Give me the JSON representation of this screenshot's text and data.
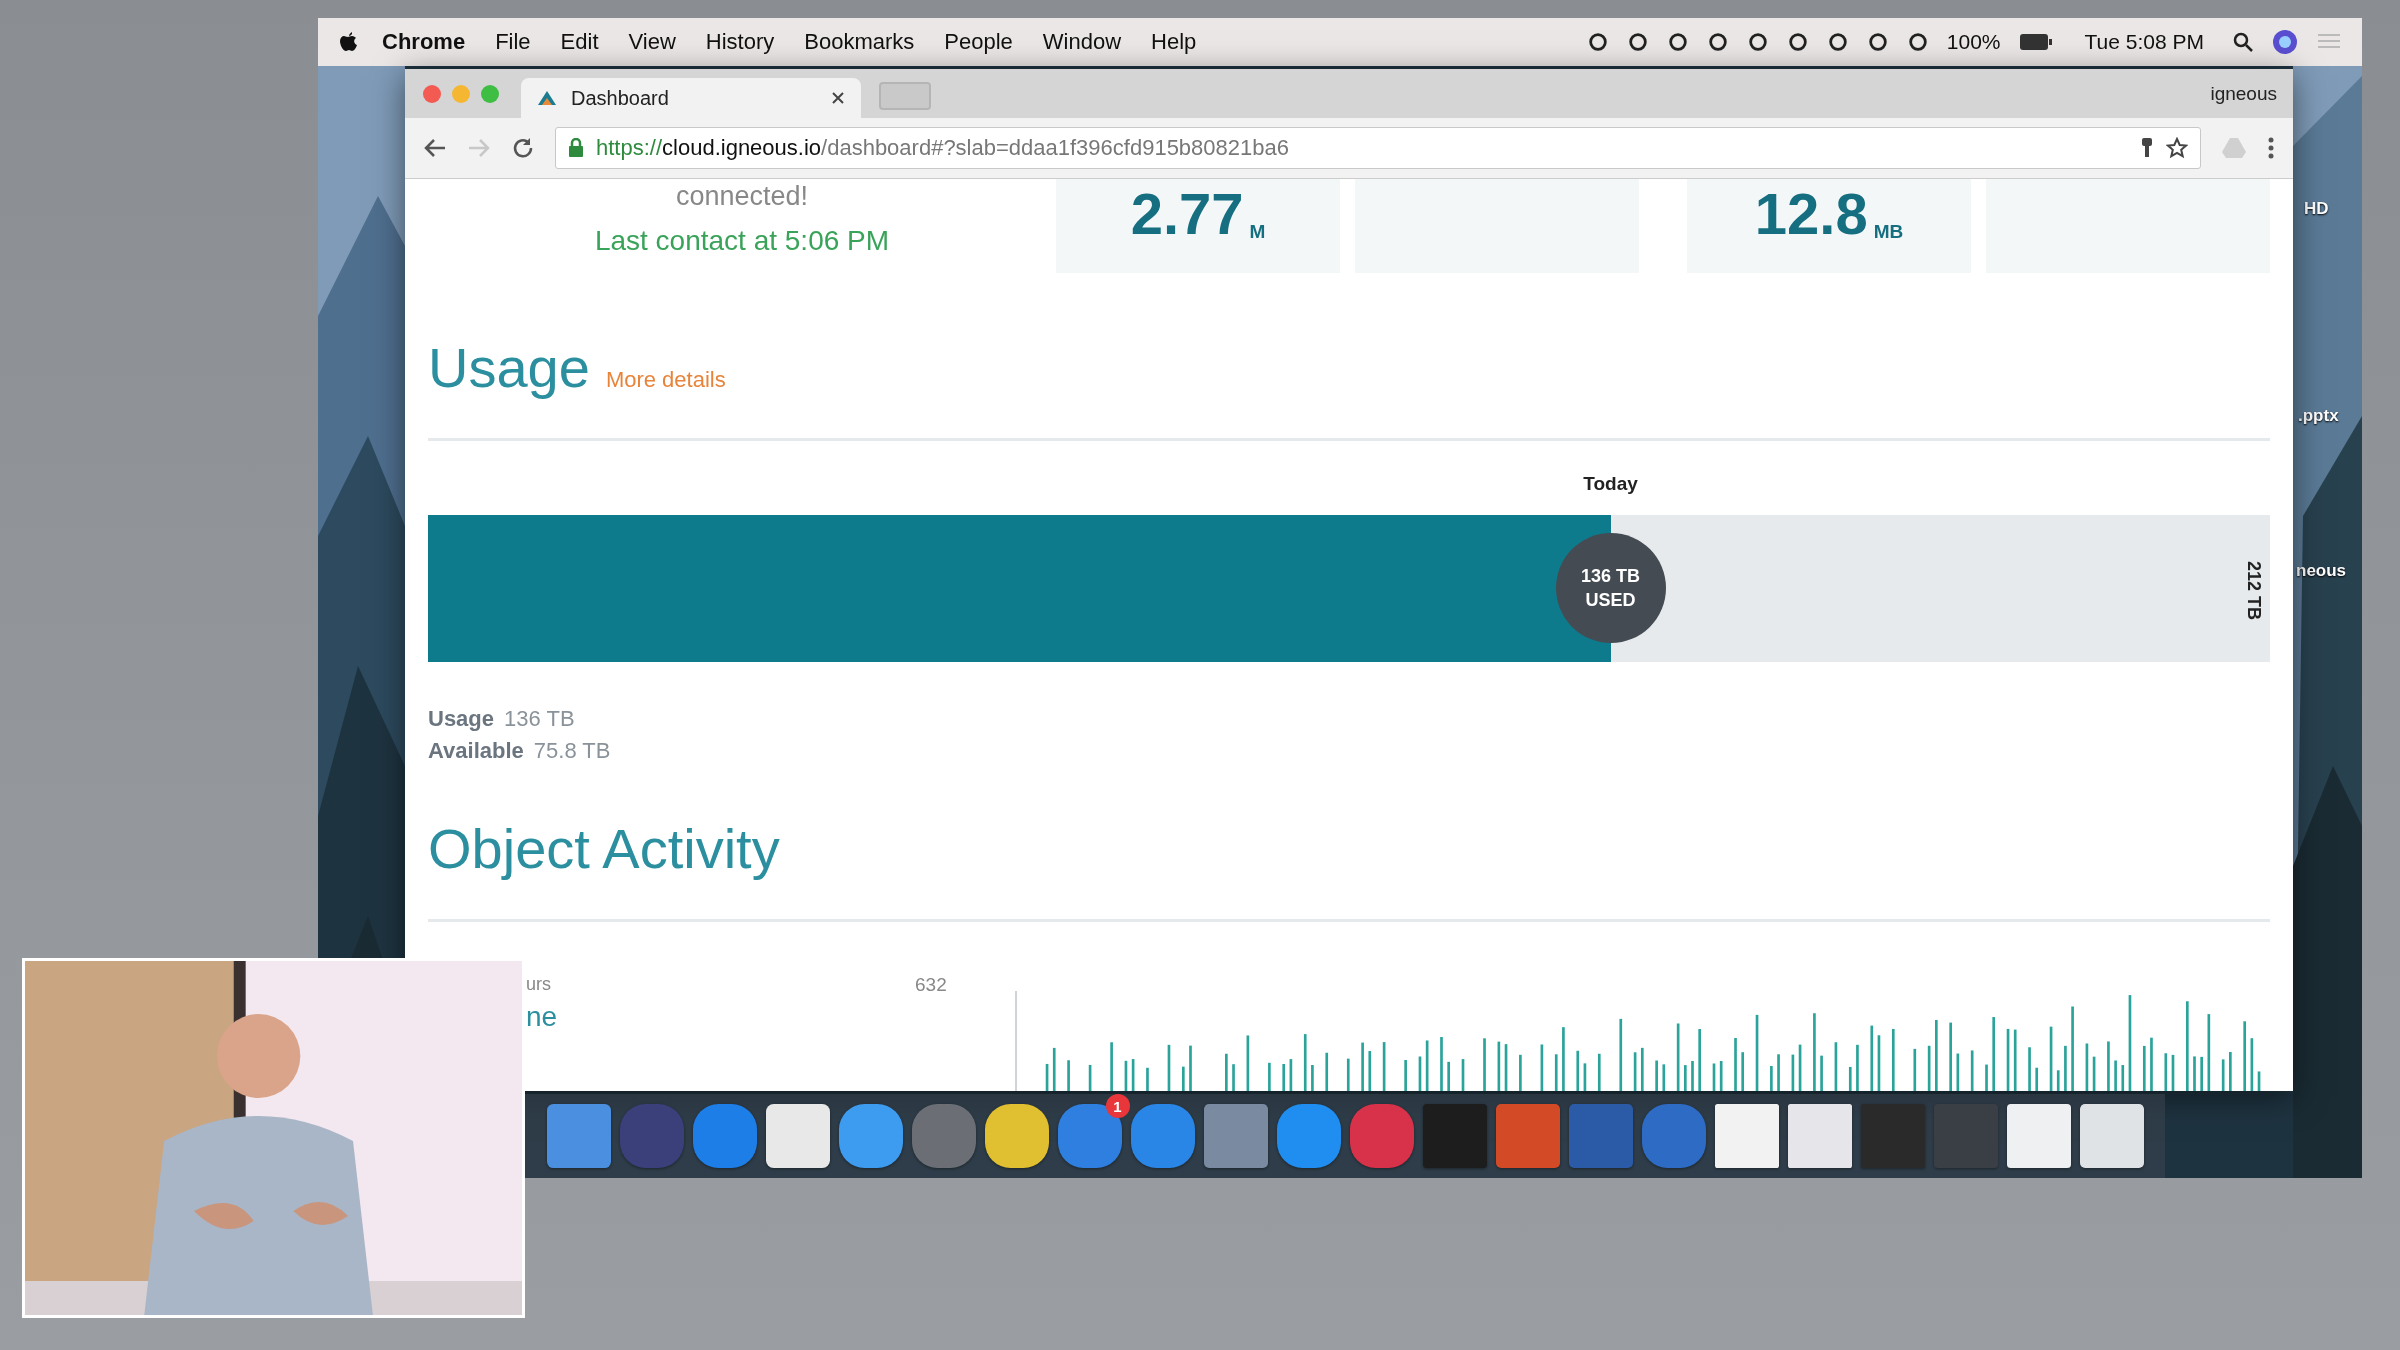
{
  "menubar": {
    "app": "Chrome",
    "menus": [
      "File",
      "Edit",
      "View",
      "History",
      "Bookmarks",
      "People",
      "Window",
      "Help"
    ],
    "battery": "100%",
    "clock": "Tue 5:08 PM"
  },
  "browser": {
    "tab_title": "Dashboard",
    "profile": "igneous",
    "url": {
      "scheme": "https://",
      "host": "cloud.igneous.io",
      "path": "/dashboard#?slab=ddaa1f396cfd915b80821ba6"
    }
  },
  "connection": {
    "status": "connected!",
    "last_contact": "Last contact at 5:06 PM"
  },
  "stat_cards": [
    {
      "kind": "value",
      "value": "2.77",
      "unit": "M"
    },
    {
      "kind": "empty"
    },
    {
      "kind": "value",
      "value": "12.8",
      "unit": "MB"
    },
    {
      "kind": "empty"
    }
  ],
  "usage": {
    "heading": "Usage",
    "link": "More details",
    "marker_label": "Today",
    "level": 0.642,
    "used_value": "136 TB",
    "used_label": "USED",
    "capacity": "212 TB",
    "stats": [
      {
        "label": "Usage",
        "value": "136 TB"
      },
      {
        "label": "Available",
        "value": "75.8 TB"
      }
    ]
  },
  "object_activity": {
    "heading": "Object Activity",
    "legend": [
      "urs",
      "ne"
    ],
    "axis_max": "632"
  },
  "dock": {
    "badge": "1"
  },
  "desktop_labels": [
    "HD",
    ".pptx",
    "neous"
  ]
}
